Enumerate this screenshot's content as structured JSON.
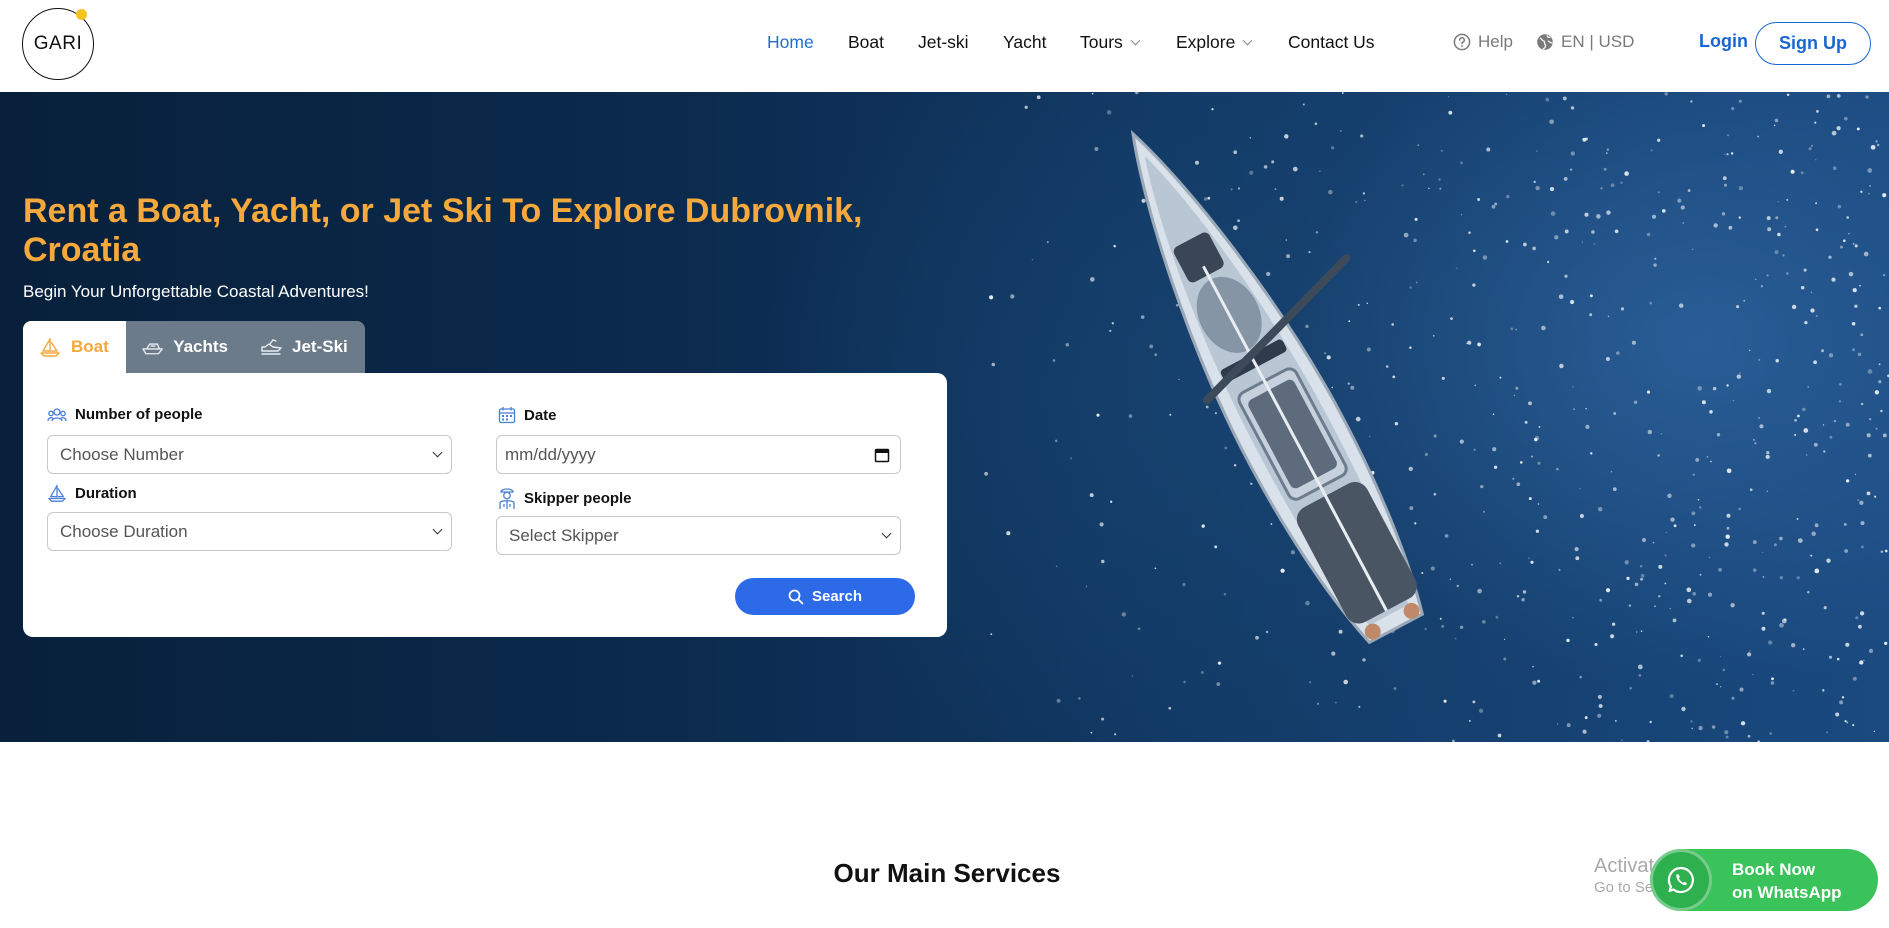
{
  "header": {
    "logo_text": "GARI",
    "nav": [
      {
        "label": "Home",
        "active": true,
        "has_dropdown": false
      },
      {
        "label": "Boat",
        "active": false,
        "has_dropdown": false
      },
      {
        "label": "Jet-ski",
        "active": false,
        "has_dropdown": false
      },
      {
        "label": "Yacht",
        "active": false,
        "has_dropdown": false
      },
      {
        "label": "Tours",
        "active": false,
        "has_dropdown": true
      },
      {
        "label": "Explore",
        "active": false,
        "has_dropdown": true
      },
      {
        "label": "Contact Us",
        "active": false,
        "has_dropdown": false
      }
    ],
    "help_label": "Help",
    "locale_label": "EN | USD",
    "login_label": "Login",
    "signup_label": "Sign Up"
  },
  "hero": {
    "title": "Rent a Boat, Yacht, or Jet Ski To Explore Dubrovnik, Croatia",
    "subtitle": "Begin Your Unforgettable Coastal Adventures!",
    "tabs": [
      {
        "label": "Boat",
        "icon": "sailboat-icon",
        "active": true
      },
      {
        "label": "Yachts",
        "icon": "yacht-icon",
        "active": false
      },
      {
        "label": "Jet-Ski",
        "icon": "jetski-icon",
        "active": false
      }
    ],
    "form": {
      "people": {
        "label": "Number of people",
        "placeholder": "Choose Number",
        "icon": "people-icon"
      },
      "duration": {
        "label": "Duration",
        "placeholder": "Choose Duration",
        "icon": "sailboat-icon"
      },
      "date": {
        "label": "Date",
        "placeholder": "mm/dd/yyyy",
        "icon": "calendar-icon"
      },
      "skipper": {
        "label": "Skipper people",
        "placeholder": "Select Skipper",
        "icon": "captain-icon"
      },
      "search_label": "Search"
    }
  },
  "services": {
    "title": "Our Main Services"
  },
  "whatsapp": {
    "line1": "Book Now",
    "line2": "on WhatsApp"
  },
  "os_watermark": {
    "line1": "Activate Wi",
    "line2": "Go to Settings to"
  },
  "colors": {
    "accent_blue": "#1f6fd1",
    "title_orange": "#f5a83c",
    "search_blue": "#2c6ae8",
    "whatsapp_green": "#3ac25b",
    "hero_navy": "#0b2a4d"
  }
}
